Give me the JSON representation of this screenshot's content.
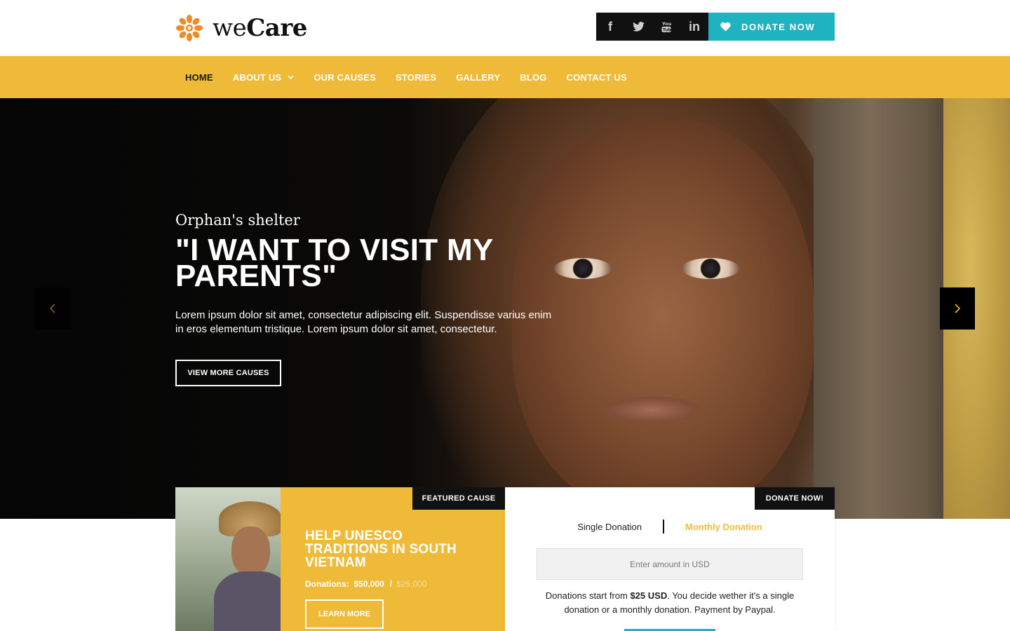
{
  "brand": {
    "name_light": "we",
    "name_bold": "Care",
    "icon": "asterisk-flower-icon",
    "accent": "#efba37",
    "teal": "#1fb3bf",
    "logo_color": "#f08a24"
  },
  "header": {
    "social": [
      {
        "icon": "facebook-icon",
        "glyph": "f"
      },
      {
        "icon": "twitter-icon",
        "glyph": ""
      },
      {
        "icon": "youtube-icon",
        "glyph": ""
      },
      {
        "icon": "linkedin-icon",
        "glyph": "in"
      }
    ],
    "donate_label": "DONATE NOW"
  },
  "nav": {
    "items": [
      {
        "label": "HOME",
        "active": true
      },
      {
        "label": "ABOUT US",
        "dropdown": true
      },
      {
        "label": "OUR CAUSES"
      },
      {
        "label": "STORIES"
      },
      {
        "label": "GALLERY"
      },
      {
        "label": "BLOG"
      },
      {
        "label": "CONTACT US"
      }
    ]
  },
  "hero": {
    "subtitle": "Orphan's shelter",
    "title": "\"I want to visit my parents\"",
    "description": "Lorem ipsum dolor sit amet, consectetur adipiscing elit. Suspendisse varius enim in eros elementum tristique. Lorem ipsum dolor sit amet, consectetur.",
    "button": "VIEW MORE CAUSES"
  },
  "featured": {
    "tag": "FEATURED CAUSE",
    "title": "Help UNESCO traditions in South Vietnam",
    "donations_label": "Donations:",
    "raised": "$50,000",
    "separator": "/",
    "goal": "$25,000",
    "button": "LEARN MORE"
  },
  "donate": {
    "tag": "DONATE NOW!",
    "single": "Single Donation",
    "monthly": "Monthly Donation",
    "placeholder": "Enter amount in USD",
    "note_before": "Donations start from ",
    "note_amount": "$25 USD",
    "note_after": ". You decide wether it's a single donation or a monthly donation. Payment by Paypal."
  }
}
